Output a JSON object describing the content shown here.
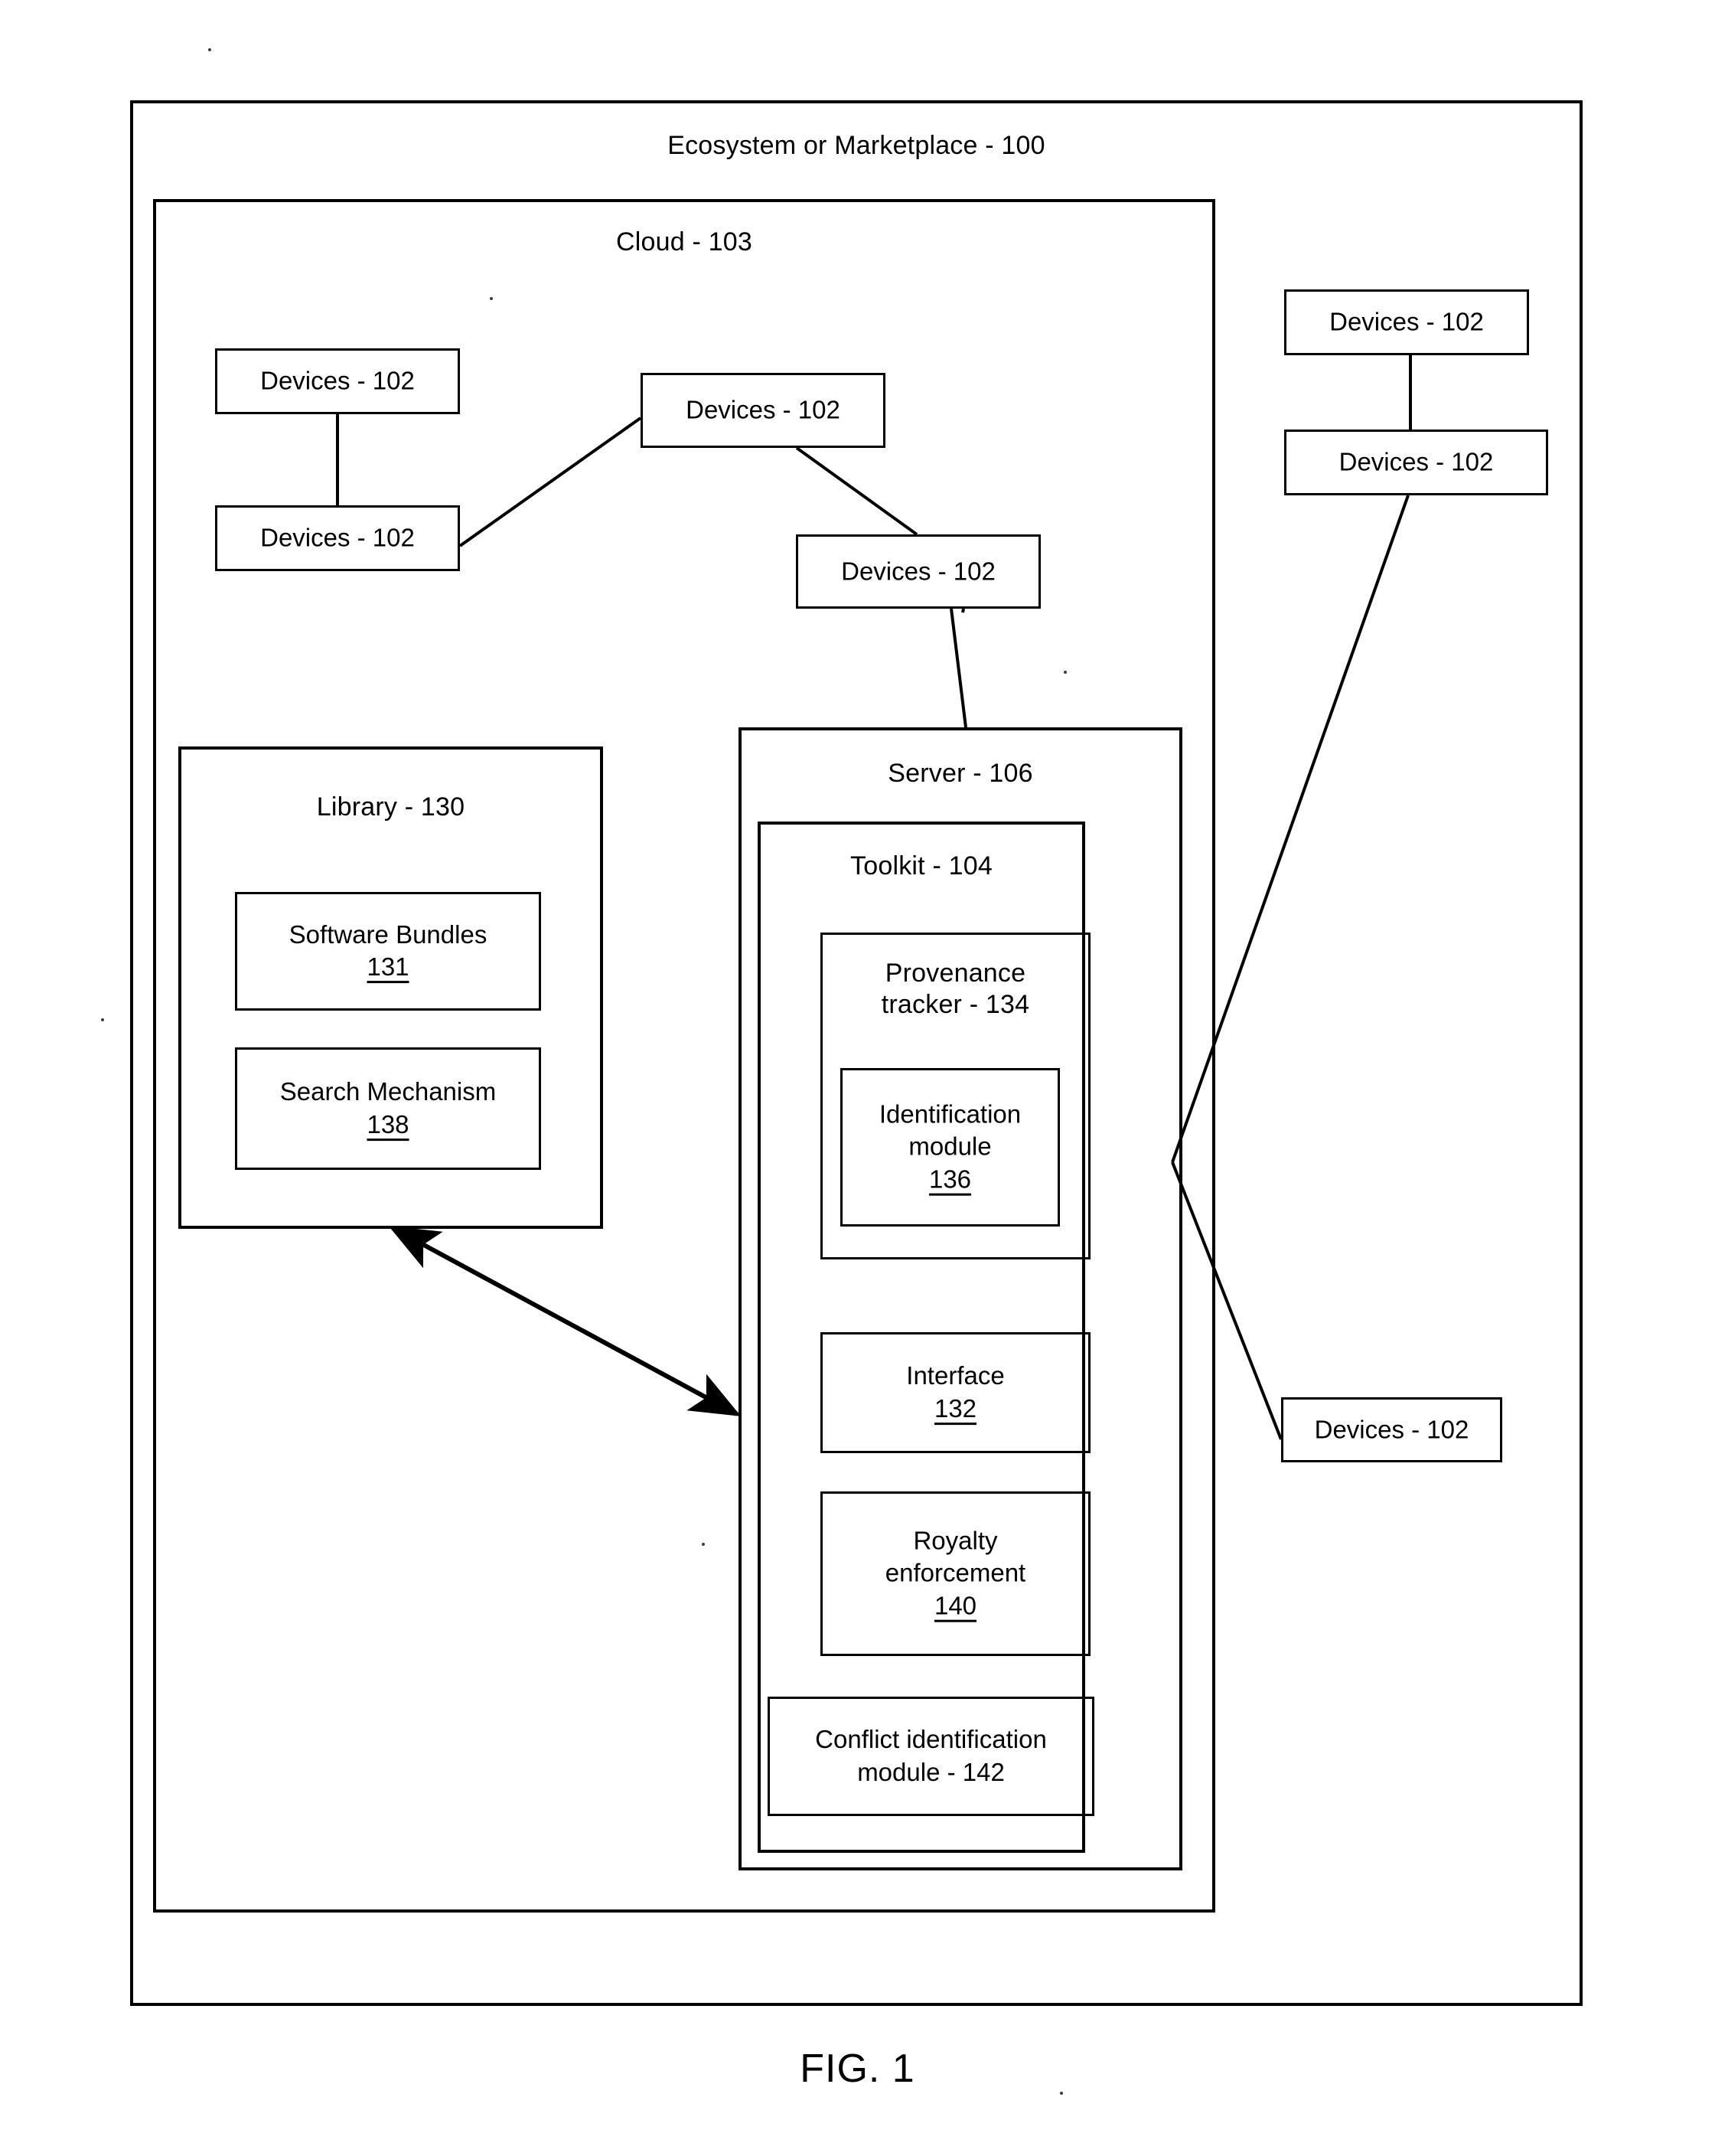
{
  "figure": {
    "caption": "FIG. 1"
  },
  "outer": {
    "title": "Ecosystem or Marketplace - 100"
  },
  "cloud": {
    "title": "Cloud - 103"
  },
  "devices": [
    {
      "label": "Devices - 102"
    },
    {
      "label": "Devices - 102"
    },
    {
      "label": "Devices - 102"
    },
    {
      "label": "Devices - 102"
    },
    {
      "label": "Devices - 102"
    },
    {
      "label": "Devices - 102"
    },
    {
      "label": "Devices - 102"
    }
  ],
  "library": {
    "title": "Library - 130",
    "items": [
      {
        "name": "Software Bundles",
        "refnum": "131"
      },
      {
        "name": "Search Mechanism",
        "refnum": "138"
      }
    ]
  },
  "server": {
    "title": "Server - 106",
    "toolkit": {
      "title": "Toolkit - 104",
      "provenance_tracker": {
        "line1": "Provenance",
        "line2": "tracker - 134",
        "identification_module": {
          "line1": "Identification",
          "line2": "module",
          "refnum": "136"
        }
      },
      "interface": {
        "name": "Interface",
        "refnum": "132"
      },
      "royalty": {
        "line1": "Royalty",
        "line2": "enforcement",
        "refnum": "140"
      },
      "conflict": {
        "line1": "Conflict identification",
        "line2": "module - 142"
      }
    }
  },
  "colors": {
    "stroke": "#000000",
    "background": "#ffffff"
  }
}
